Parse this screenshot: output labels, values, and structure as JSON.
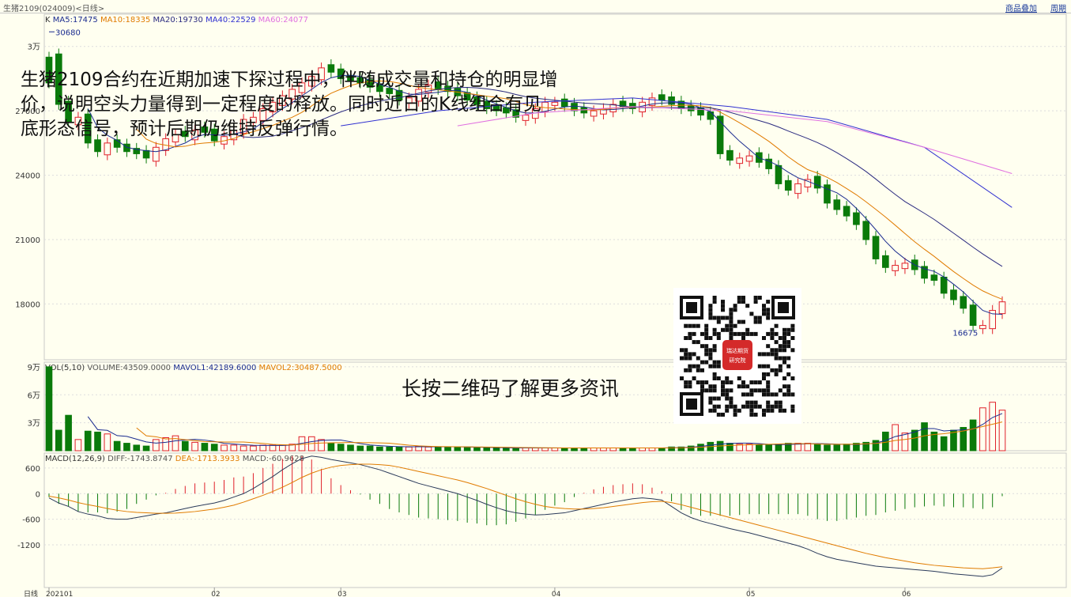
{
  "window": {
    "title": "生猪2109(024009)<日线>",
    "link_overlay": "商品叠加",
    "link_period": "周期"
  },
  "overlay": {
    "text_lines": [
      "生猪2109合约在近期加速下探过程中，伴随成交量和持仓的明显增",
      "价，说明空头力量得到一定程度的释放。同时近日的K线组合有见",
      "底形态信号，预计后期仍维持反弹行情。"
    ],
    "qr_caption": "长按二维码了解更多资讯",
    "qr_badge": [
      "瑞达期货",
      "研究院"
    ]
  },
  "chart_data": [
    {
      "type": "candlestick",
      "panel": "price",
      "indicator_label": "K",
      "legend": [
        {
          "name": "MA5",
          "value": "17475",
          "color": "#1a2b8f"
        },
        {
          "name": "MA10",
          "value": "18335",
          "color": "#e07b00"
        },
        {
          "name": "MA20",
          "value": "19730",
          "color": "#2b2b80"
        },
        {
          "name": "MA40",
          "value": "22529",
          "color": "#3030d0"
        },
        {
          "name": "MA60",
          "value": "24077",
          "color": "#e070e0"
        }
      ],
      "ylim": [
        15400,
        31500
      ],
      "yticks": [
        {
          "v": 30000,
          "label": "3万"
        },
        {
          "v": 27000,
          "label": "27000"
        },
        {
          "v": 24000,
          "label": "24000"
        },
        {
          "v": 21000,
          "label": "21000"
        },
        {
          "v": 18000,
          "label": "18000"
        }
      ],
      "annotations": [
        {
          "text": "30680",
          "value": 30680
        },
        {
          "text": "16675",
          "value": 16675
        }
      ],
      "closes": [
        29500,
        27300,
        26500,
        26700,
        25500,
        25100,
        25500,
        25300,
        25100,
        25000,
        24800,
        25300,
        25700,
        25900,
        25800,
        26100,
        26000,
        25600,
        25800,
        26100,
        26600,
        26700,
        27100,
        27400,
        27700,
        28000,
        28300,
        28600,
        29000,
        28800,
        28500,
        28400,
        28300,
        28100,
        27900,
        27800,
        27500,
        27600,
        28000,
        28200,
        28000,
        27900,
        27700,
        27500,
        27300,
        27100,
        27000,
        26900,
        26700,
        26800,
        27100,
        27400,
        27400,
        27200,
        27000,
        26900,
        27000,
        27100,
        27300,
        27200,
        27100,
        27400,
        27600,
        27500,
        27300,
        27100,
        27000,
        26800,
        26600,
        25000,
        24700,
        24800,
        24900,
        24600,
        24300,
        23600,
        23300,
        23600,
        23800,
        23400,
        22700,
        22400,
        22100,
        21700,
        21000,
        20100,
        19700,
        19800,
        19900,
        19600,
        19200,
        19100,
        18500,
        18200,
        17800,
        17000,
        17000,
        17700,
        18100
      ],
      "up": [
        false,
        false,
        false,
        true,
        false,
        false,
        true,
        false,
        false,
        false,
        false,
        true,
        true,
        true,
        false,
        true,
        false,
        false,
        true,
        true,
        true,
        true,
        true,
        true,
        true,
        true,
        true,
        true,
        true,
        false,
        false,
        false,
        false,
        false,
        false,
        false,
        false,
        true,
        true,
        true,
        false,
        false,
        false,
        false,
        false,
        false,
        false,
        false,
        false,
        true,
        true,
        true,
        true,
        false,
        false,
        false,
        true,
        true,
        true,
        false,
        false,
        true,
        true,
        false,
        false,
        false,
        false,
        false,
        false,
        false,
        false,
        true,
        true,
        false,
        false,
        false,
        false,
        true,
        true,
        false,
        false,
        false,
        false,
        false,
        false,
        false,
        false,
        true,
        true,
        false,
        false,
        false,
        false,
        false,
        false,
        false,
        true,
        true,
        true
      ],
      "ma5_last": 17475,
      "ma10_last": 18335,
      "ma20_last": 19730,
      "ma40_last": 22529,
      "ma60_last": 24077,
      "ma40_points": [
        [
          30,
          26300
        ],
        [
          40,
          27000
        ],
        [
          50,
          27400
        ],
        [
          60,
          27600
        ],
        [
          70,
          27200
        ],
        [
          80,
          26600
        ],
        [
          90,
          25300
        ],
        [
          99,
          22500
        ]
      ],
      "ma60_points": [
        [
          42,
          26300
        ],
        [
          50,
          26900
        ],
        [
          60,
          27200
        ],
        [
          70,
          27000
        ],
        [
          80,
          26500
        ],
        [
          90,
          25300
        ],
        [
          99,
          24077
        ]
      ]
    },
    {
      "type": "bar",
      "panel": "volume",
      "indicator_label": "VOL(5,10)",
      "legend": [
        {
          "name": "VOLUME",
          "value": "43509.0000",
          "color": "#555555"
        },
        {
          "name": "MAVOL1",
          "value": "42189.6000",
          "color": "#1a2b8f"
        },
        {
          "name": "MAVOL2",
          "value": "30487.5000",
          "color": "#e07b00"
        }
      ],
      "ylim": [
        0,
        95000
      ],
      "yticks": [
        {
          "v": 90000,
          "label": "9万"
        },
        {
          "v": 60000,
          "label": "6万"
        },
        {
          "v": 30000,
          "label": "3万"
        }
      ],
      "values": [
        90000,
        22000,
        38000,
        12000,
        21000,
        20000,
        18000,
        10000,
        8000,
        6000,
        5000,
        12000,
        14000,
        16000,
        10000,
        9000,
        8000,
        7000,
        6000,
        6000,
        5000,
        5000,
        6000,
        6000,
        6000,
        7000,
        15000,
        15000,
        12000,
        8000,
        7000,
        6000,
        5000,
        5000,
        4000,
        4000,
        4000,
        4000,
        5000,
        4000,
        4000,
        4000,
        4000,
        4000,
        3000,
        3000,
        3000,
        3000,
        3000,
        3000,
        3000,
        3000,
        3000,
        3000,
        3000,
        3000,
        3000,
        3000,
        3000,
        3000,
        3000,
        3000,
        3000,
        3000,
        4000,
        4000,
        5000,
        7000,
        9000,
        10000,
        8000,
        7000,
        7000,
        6000,
        6000,
        7000,
        8000,
        8000,
        8000,
        7000,
        6000,
        6000,
        7000,
        8000,
        9000,
        11000,
        20000,
        28000,
        19000,
        22000,
        30000,
        20000,
        15000,
        22000,
        25000,
        33000,
        46000,
        52000,
        43509
      ],
      "mavol1_last": 42189.6,
      "mavol2_last": 30487.5
    },
    {
      "type": "macd",
      "panel": "macd",
      "indicator_label": "MACD(12,26,9)",
      "legend": [
        {
          "name": "DIFF",
          "value": "-1743.8747",
          "color": "#555555"
        },
        {
          "name": "DEA",
          "value": "-1713.3933",
          "color": "#e07b00"
        },
        {
          "name": "MACD",
          "value": "-60.9628",
          "color": "#555555"
        }
      ],
      "ylim": [
        -2200,
        950
      ],
      "yticks": [
        {
          "v": 600,
          "label": "600"
        },
        {
          "v": 0,
          "label": "0"
        },
        {
          "v": -600,
          "label": "-600"
        },
        {
          "v": -1200,
          "label": "-1200"
        }
      ],
      "diff": [
        -100,
        -220,
        -300,
        -420,
        -480,
        -520,
        -580,
        -600,
        -600,
        -560,
        -520,
        -480,
        -450,
        -400,
        -350,
        -300,
        -260,
        -220,
        -160,
        -80,
        0,
        120,
        260,
        400,
        560,
        700,
        820,
        880,
        850,
        800,
        760,
        720,
        680,
        620,
        560,
        480,
        400,
        320,
        240,
        180,
        120,
        60,
        0,
        -80,
        -160,
        -250,
        -330,
        -400,
        -450,
        -480,
        -500,
        -490,
        -470,
        -450,
        -400,
        -350,
        -300,
        -250,
        -200,
        -160,
        -120,
        -100,
        -120,
        -150,
        -300,
        -450,
        -560,
        -640,
        -700,
        -760,
        -820,
        -870,
        -920,
        -980,
        -1040,
        -1100,
        -1160,
        -1220,
        -1300,
        -1400,
        -1480,
        -1540,
        -1580,
        -1620,
        -1660,
        -1700,
        -1720,
        -1740,
        -1760,
        -1780,
        -1800,
        -1820,
        -1850,
        -1880,
        -1900,
        -1920,
        -1940,
        -1900,
        -1743.87
      ],
      "dea": [
        -60,
        -100,
        -150,
        -210,
        -260,
        -300,
        -350,
        -390,
        -420,
        -440,
        -450,
        -460,
        -460,
        -455,
        -440,
        -420,
        -390,
        -360,
        -320,
        -270,
        -200,
        -120,
        -40,
        50,
        150,
        260,
        380,
        480,
        560,
        620,
        660,
        680,
        690,
        690,
        680,
        660,
        620,
        570,
        520,
        470,
        420,
        370,
        320,
        260,
        190,
        120,
        40,
        -40,
        -120,
        -190,
        -250,
        -300,
        -330,
        -350,
        -360,
        -360,
        -350,
        -330,
        -300,
        -270,
        -240,
        -210,
        -190,
        -180,
        -210,
        -260,
        -320,
        -380,
        -440,
        -500,
        -560,
        -620,
        -680,
        -740,
        -800,
        -860,
        -920,
        -980,
        -1040,
        -1100,
        -1160,
        -1220,
        -1280,
        -1340,
        -1400,
        -1450,
        -1500,
        -1540,
        -1580,
        -1620,
        -1650,
        -1680,
        -1700,
        -1720,
        -1740,
        -1750,
        -1760,
        -1740,
        -1713.39
      ]
    }
  ],
  "x_axis": {
    "label": "日线",
    "ticks": [
      {
        "i": 0,
        "label": "202101"
      },
      {
        "i": 17,
        "label": "02"
      },
      {
        "i": 30,
        "label": "03"
      },
      {
        "i": 52,
        "label": "04"
      },
      {
        "i": 72,
        "label": "05"
      },
      {
        "i": 88,
        "label": "06"
      }
    ]
  }
}
